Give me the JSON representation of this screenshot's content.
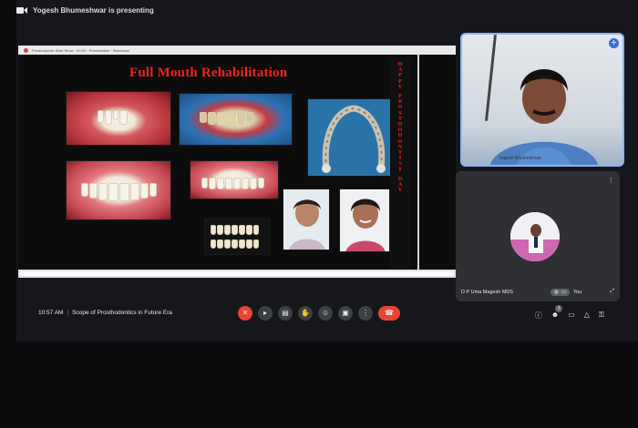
{
  "topbar": {
    "presenting_text": "Yogesh Bhumeshwar is presenting"
  },
  "slide": {
    "title": "Full Mouth Rehabilitation",
    "banner_lines": [
      "H",
      "A",
      "P",
      "P",
      "Y",
      "",
      "P",
      "R",
      "O",
      "S",
      "T",
      "H",
      "O",
      "D",
      "O",
      "N",
      "T",
      "I",
      "S",
      "T",
      "",
      "D",
      "A",
      "Y"
    ]
  },
  "browser": {
    "tab_text": "Prosthodontic Slide Show · 00:00 · Presentation · Slideshow"
  },
  "participants": [
    {
      "name": "Yogesh Bhumeshwar",
      "tile": "speaker"
    },
    {
      "name": "D P Uma Magesh MDS",
      "tag": "You"
    }
  ],
  "bottom": {
    "time": "10:57 AM",
    "meeting_title": "Scope of Prosthodontics in Future Era",
    "participant_count": "3"
  },
  "colors": {
    "accent": "#8ab4f8",
    "danger": "#ea4335",
    "title_red": "#e8241e"
  }
}
